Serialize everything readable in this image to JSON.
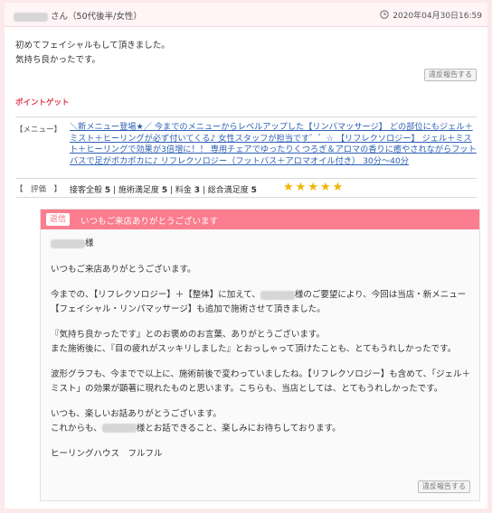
{
  "review": {
    "reviewer_suffix": "さん（50代後半/女性）",
    "date": "2020年04月30日16:59",
    "text_lines": [
      "初めてフェイシャルもして頂きました。",
      "気持ち良かったです。"
    ],
    "report_label": "違反報告する"
  },
  "point": {
    "label": "ポイントゲット"
  },
  "menu": {
    "label": "【メニュー】",
    "link_text": "＼新メニュー登場★／ 今までのメニューからレベルアップした【リンパマッサージ】 どの部位にもジェル＋ミスト＋ヒーリングが必ず付いてくる♪ 女性スタッフが担当です゛゛☆ 【リフレクソロジー】 ジェル＋ミスト＋ヒーリングで効果が3倍増に！！ 専用チェアでゆったりくつろぎ＆アロマの香りに癒やされながらフットバスで足がポカポカに♪ リフレクソロジー（フットバス＋アロマオイル付き） 30分～40分"
  },
  "evaluation": {
    "label": "【　評価　】",
    "overall_label": "接客全般",
    "overall_value": "5",
    "treatment_label": "施術満足度",
    "treatment_value": "5",
    "price_label": "料金",
    "price_value": "3",
    "total_label": "総合満足度",
    "total_value": "5",
    "stars": 5
  },
  "reply": {
    "badge": "返信",
    "title": "いつもご来店ありがとうございます",
    "salutation_suffix": "様",
    "thanks": "いつもご来店ありがとうございます。",
    "p2_before": "今までの、【リフレクソロジー】＋【整体】に加えて、",
    "p2_after": "様のご要望により、今回は当店・新メニュー【フェイシャル・リンパマッサージ】も追加で施術させて頂きました。",
    "p3_line1": "『気持ち良かったです』とのお褒めのお言葉、ありがとうございます。",
    "p3_line2": "また施術後に、『目の疲れがスッキリしました』とおっしゃって頂けたことも、とてもうれしかったです。",
    "p4": "波形グラフも、今までで以上に、施術前後で変わっていましたね。【リフレクソロジー】も含めて、「ジェル＋ミスト」の効果が顕著に現れたものと思います。こちらも、当店としては、とてもうれしかったです。",
    "p5_line1": "いつも、楽しいお話ありがとうございます。",
    "p5_before": "これからも、",
    "p5_after": "様とお話できること、楽しみにお待ちしております。",
    "signature": "ヒーリングハウス　フルフル",
    "report_label": "違反報告する"
  },
  "colors": {
    "accent": "#fb7d8f",
    "point": "#e4374f",
    "link": "#2c5fb4",
    "star": "#f2b400"
  }
}
